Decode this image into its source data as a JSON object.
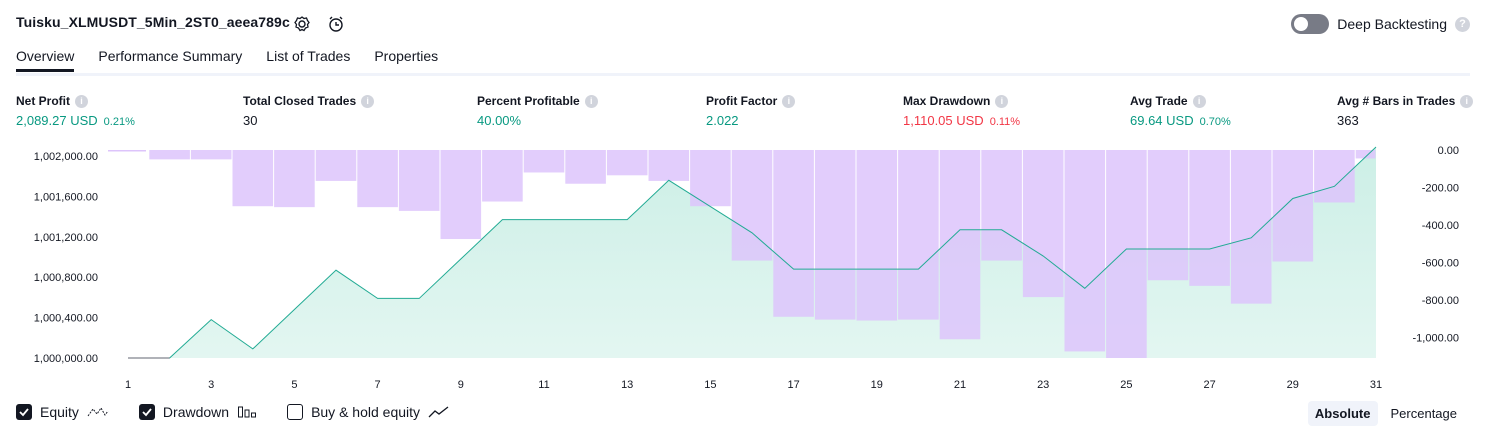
{
  "header": {
    "title": "Tuisku_XLMUSDT_5Min_2ST0_aeea789c",
    "deep_backtesting_label": "Deep Backtesting"
  },
  "tabs": [
    "Overview",
    "Performance Summary",
    "List of Trades",
    "Properties"
  ],
  "metrics": {
    "net_profit": {
      "label": "Net Profit",
      "value": "2,089.27 USD",
      "pct": "0.21%"
    },
    "total_closed_trades": {
      "label": "Total Closed Trades",
      "value": "30"
    },
    "percent_profitable": {
      "label": "Percent Profitable",
      "value": "40.00%"
    },
    "profit_factor": {
      "label": "Profit Factor",
      "value": "2.022"
    },
    "max_drawdown": {
      "label": "Max Drawdown",
      "value": "1,110.05 USD",
      "pct": "0.11%"
    },
    "avg_trade": {
      "label": "Avg Trade",
      "value": "69.64 USD",
      "pct": "0.70%"
    },
    "avg_bars": {
      "label": "Avg # Bars in Trades",
      "value": "363"
    }
  },
  "legend": {
    "equity": "Equity",
    "drawdown": "Drawdown",
    "buy_hold": "Buy & hold equity",
    "absolute": "Absolute",
    "percentage": "Percentage"
  },
  "colors": {
    "equity_line": "#22ab94",
    "equity_fill": "#ccefe6",
    "drawdown_bar": "#ddc4fb",
    "drawdown_bar_overlap": "#c4b6ef",
    "green": "#089981",
    "red": "#f23645"
  },
  "chart_data": {
    "type": "area",
    "x_tick_labels": [
      "1",
      "3",
      "5",
      "7",
      "9",
      "11",
      "13",
      "15",
      "17",
      "19",
      "21",
      "23",
      "25",
      "27",
      "29",
      "31"
    ],
    "series": [
      {
        "name": "Equity",
        "x": [
          1,
          2,
          3,
          4,
          5,
          6,
          7,
          8,
          9,
          10,
          11,
          12,
          13,
          14,
          15,
          16,
          17,
          18,
          19,
          20,
          21,
          22,
          23,
          24,
          25,
          26,
          27,
          28,
          29,
          30,
          31
        ],
        "values": [
          1000000,
          1000000,
          1000380,
          1000090,
          1000480,
          1000870,
          1000590,
          1000590,
          1000980,
          1001370,
          1001370,
          1001370,
          1001370,
          1001760,
          1001500,
          1001240,
          1000880,
          1000880,
          1000880,
          1000880,
          1001270,
          1001270,
          1001010,
          1000690,
          1001080,
          1001080,
          1001080,
          1001190,
          1001580,
          1001700,
          1002090
        ]
      },
      {
        "name": "Drawdown",
        "x": [
          1,
          2,
          3,
          4,
          5,
          6,
          7,
          8,
          9,
          10,
          11,
          12,
          13,
          14,
          15,
          16,
          17,
          18,
          19,
          20,
          21,
          22,
          23,
          24,
          25,
          26,
          27,
          28,
          29,
          30,
          31
        ],
        "values": [
          0,
          -50,
          -50,
          -300,
          -305,
          -165,
          -305,
          -325,
          -475,
          -275,
          -120,
          -180,
          -135,
          -165,
          -300,
          -590,
          -890,
          -905,
          -910,
          -905,
          -1010,
          -590,
          -785,
          -1075,
          -1110,
          -695,
          -725,
          -820,
          -595,
          -280,
          -45
        ]
      }
    ],
    "y_left": {
      "ticks": [
        "1,000,000.00",
        "1,000,400.00",
        "1,000,800.00",
        "1,001,200.00",
        "1,001,600.00",
        "1,002,000.00"
      ],
      "range": [
        1000000,
        1002060
      ]
    },
    "y_right": {
      "ticks": [
        "0.00",
        "-200.00",
        "-400.00",
        "-600.00",
        "-800.00",
        "-1,000.00"
      ],
      "range": [
        0,
        -1110
      ]
    }
  }
}
